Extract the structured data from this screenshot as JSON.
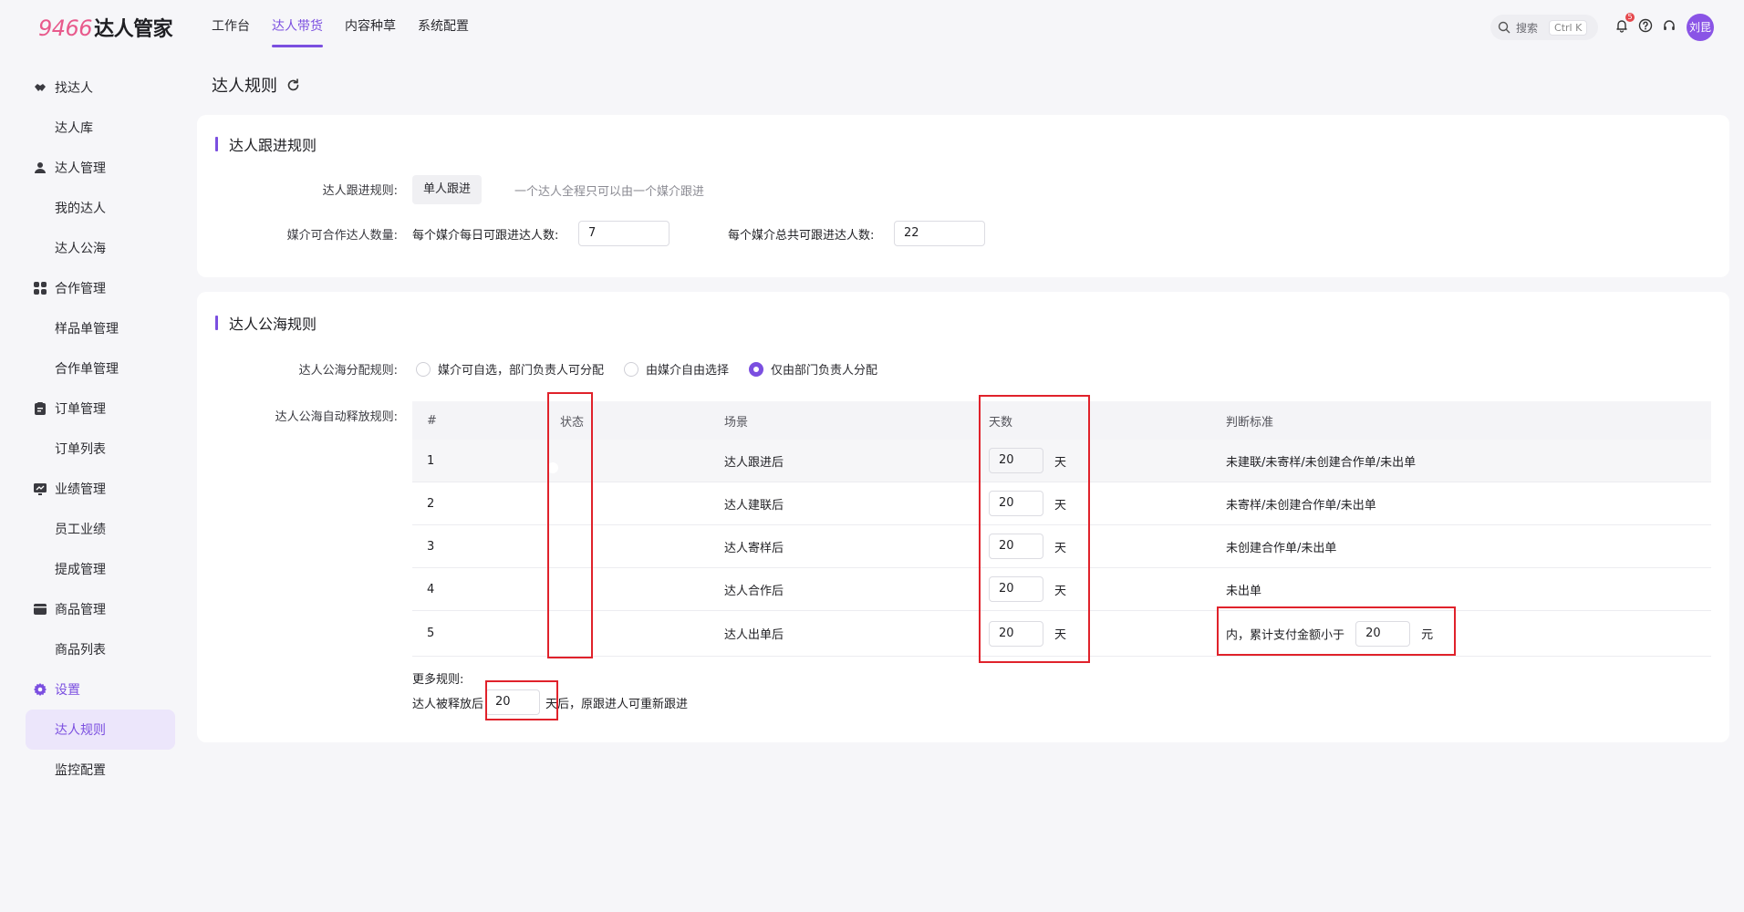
{
  "app": {
    "logo_number": "9466",
    "logo_text": "达人管家"
  },
  "topnav": {
    "items": [
      {
        "label": "工作台",
        "active": false
      },
      {
        "label": "达人带货",
        "active": true
      },
      {
        "label": "内容种草",
        "active": false
      },
      {
        "label": "系统配置",
        "active": false
      }
    ]
  },
  "search": {
    "label": "搜索",
    "shortcut": "Ctrl K"
  },
  "notifications": {
    "count": "5"
  },
  "user": {
    "avatar_text": "刘昆"
  },
  "sidebar": {
    "groups": [
      {
        "label": "找达人",
        "icon": "handshake-icon",
        "items": [
          "达人库"
        ]
      },
      {
        "label": "达人管理",
        "icon": "user-icon",
        "items": [
          "我的达人",
          "达人公海"
        ]
      },
      {
        "label": "合作管理",
        "icon": "grid-icon",
        "items": [
          "样品单管理",
          "合作单管理"
        ]
      },
      {
        "label": "订单管理",
        "icon": "clipboard-icon",
        "items": [
          "订单列表"
        ]
      },
      {
        "label": "业绩管理",
        "icon": "chart-icon",
        "items": [
          "员工业绩",
          "提成管理"
        ]
      },
      {
        "label": "商品管理",
        "icon": "box-icon",
        "items": [
          "商品列表"
        ]
      },
      {
        "label": "设置",
        "icon": "gear-icon",
        "items": [
          "达人规则",
          "监控配置"
        ]
      }
    ],
    "active_item": "达人规则"
  },
  "page": {
    "title": "达人规则"
  },
  "follow_rules": {
    "title": "达人跟进规则",
    "rule_label": "达人跟进规则:",
    "rule_value": "单人跟进",
    "rule_hint": "一个达人全程只可以由一个媒介跟进",
    "quota_label": "媒介可合作达人数量:",
    "daily_label": "每个媒介每日可跟进达人数:",
    "daily_value": "7",
    "total_label": "每个媒介总共可跟进达人数:",
    "total_value": "22"
  },
  "pool_rules": {
    "title": "达人公海规则",
    "assign_label": "达人公海分配规则:",
    "assign_options": [
      {
        "label": "媒介可自选，部门负责人可分配",
        "selected": false
      },
      {
        "label": "由媒介自由选择",
        "selected": false
      },
      {
        "label": "仅由部门负责人分配",
        "selected": true
      }
    ],
    "release_label": "达人公海自动释放规则:",
    "table": {
      "headers": [
        "#",
        "状态",
        "场景",
        "天数",
        "判断标准"
      ],
      "rows": [
        {
          "num": "1",
          "enabled": true,
          "scene": "达人跟进后",
          "days": "20",
          "unit": "天",
          "criteria": "未建联/未寄样/未创建合作单/未出单"
        },
        {
          "num": "2",
          "enabled": true,
          "scene": "达人建联后",
          "days": "20",
          "unit": "天",
          "criteria": "未寄样/未创建合作单/未出单"
        },
        {
          "num": "3",
          "enabled": true,
          "scene": "达人寄样后",
          "days": "20",
          "unit": "天",
          "criteria": "未创建合作单/未出单"
        },
        {
          "num": "4",
          "enabled": true,
          "scene": "达人合作后",
          "days": "20",
          "unit": "天",
          "criteria": "未出单"
        },
        {
          "num": "5",
          "enabled": true,
          "scene": "达人出单后",
          "days": "20",
          "unit": "天",
          "criteria_prefix": "内，累计支付金额小于",
          "criteria_amount": "20",
          "criteria_unit": "元"
        }
      ]
    },
    "more_title": "更多规则:",
    "more_prefix": "达人被释放后",
    "more_days": "20",
    "more_suffix": "天后，原跟进人可重新跟进"
  },
  "colors": {
    "accent": "#7b4fe0",
    "highlight_box": "#e0222b"
  }
}
